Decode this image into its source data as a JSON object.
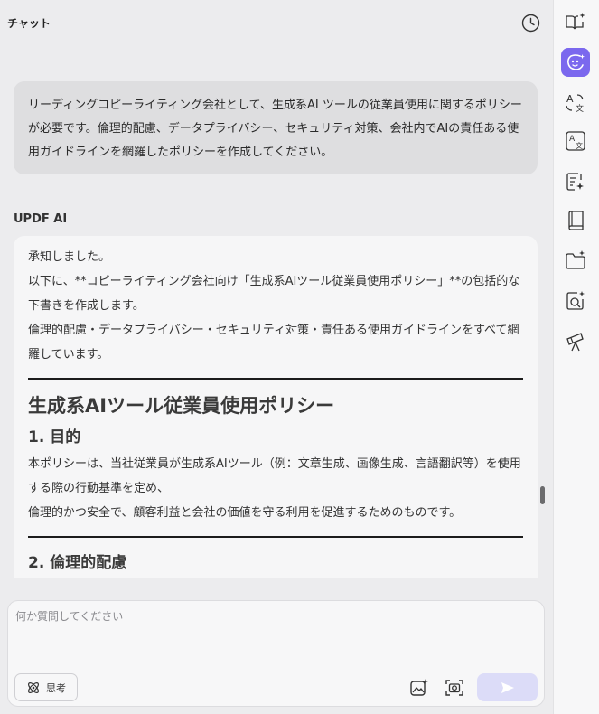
{
  "header": {
    "title": "チャット",
    "history_icon": "clock-icon"
  },
  "conversation": {
    "user_message": "リーディングコピーライティング会社として、生成系AI ツールの従業員使用に関するポリシーが必要です。倫理的配慮、データプライバシー、セキュリティ対策、会社内でAIの責任ある使用ガイドラインを網羅したポリシーを作成してください。",
    "ai_label": "UPDF AI",
    "ai_response": {
      "intro_1": "承知しました。",
      "intro_2": "以下に、**コピーライティング会社向け「生成系AIツール従業員使用ポリシー」**の包括的な下書きを作成します。",
      "intro_3": "倫理的配慮・データプライバシー・セキュリティ対策・責任ある使用ガイドラインをすべて網羅しています。",
      "title": "生成系AIツール従業員使用ポリシー",
      "section1_heading": "1. 目的",
      "section1_body_1": "本ポリシーは、当社従業員が生成系AIツール（例：文章生成、画像生成、言語翻訳等）を使用する際の行動基準を定め、",
      "section1_body_2": "倫理的かつ安全で、顧客利益と会社の価値を守る利用を促進するためのものです。",
      "section2_heading": "2. 倫理的配慮"
    }
  },
  "composer": {
    "placeholder": "何か質問してください",
    "value": "",
    "think_label": "思考",
    "think_icon": "atom-icon",
    "image_icon": "image-sparkle-icon",
    "screenshot_icon": "camera-icon",
    "send_icon": "send-icon"
  },
  "rightbar": {
    "items": [
      {
        "icon": "book-sparkle-icon",
        "active": false
      },
      {
        "icon": "ai-assistant-icon",
        "active": true
      },
      {
        "icon": "translate-icon",
        "active": false
      },
      {
        "icon": "translate-box-icon",
        "active": false
      },
      {
        "icon": "document-sparkle-icon",
        "active": false
      },
      {
        "icon": "book-icon",
        "active": false
      },
      {
        "icon": "folder-sparkle-icon",
        "active": false
      },
      {
        "icon": "search-sparkle-icon",
        "active": false
      },
      {
        "icon": "telescope-icon",
        "active": false
      }
    ],
    "accent_color": "#7b68ee"
  }
}
